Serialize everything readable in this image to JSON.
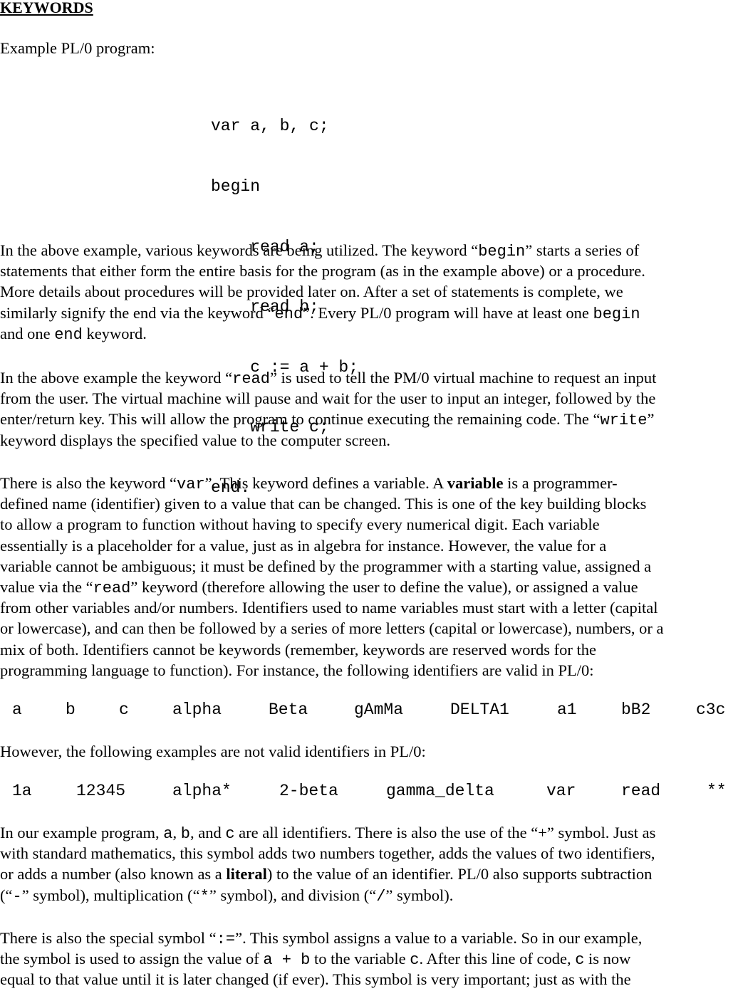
{
  "title": "KEYWORDS",
  "intro": "Example PL/0 program:",
  "code_lines": [
    "var a, b, c;",
    "begin",
    "    read a;",
    "    read b;",
    "    c := a + b;",
    "    write c;",
    "end."
  ],
  "p1": {
    "l1a": "In the above example, various keywords are being utilized.  The keyword “",
    "l1k": "begin",
    "l1b": "” starts a series of",
    "l2": "statements that either form the entire basis for the program (as in the example above) or a procedure.",
    "l3": "More details about procedures will be provided later on.  After a set of statements is complete, we",
    "l4a": "similarly signify the end via the keyword “",
    "l4k": "end",
    "l4b": "”.  Every PL/0 program will have at least one ",
    "l4k2": "begin",
    "l5a": "and one ",
    "l5k": "end",
    "l5b": " keyword."
  },
  "p2": {
    "l1a": "In the above example the keyword “",
    "l1k": "read",
    "l1b": "” is used to tell the PM/0 virtual machine to request an input",
    "l2": "from the user.  The virtual machine will pause and wait for the user to input an integer, followed by the",
    "l3a": "enter/return key.  This will allow the program to continue executing the remaining code.  The “",
    "l3k": "write",
    "l3b": "”",
    "l4": "keyword displays the specified value to the computer screen."
  },
  "p3": {
    "l1a": "There is also the keyword “",
    "l1k": "var",
    "l1b": "”.  This keyword defines a variable.  A ",
    "l1bold": "variable",
    "l1c": " is a programmer-",
    "l2": "defined name (identifier) given to a value that can be changed.  This is one of the key building blocks",
    "l3": "to allow a program to function without having to specify every numerical digit.  Each variable",
    "l4": "essentially is a placeholder for a value, just as in algebra for instance.  However, the value for a",
    "l5": "variable cannot be ambiguous; it must be defined by the programmer with a starting value, assigned a",
    "l6a": "value via the “",
    "l6k": "read",
    "l6b": "” keyword (therefore allowing the user to define the value), or assigned a value",
    "l7": "from other variables and/or numbers.  Identifiers used to name variables must start with a letter (capital",
    "l8": "or lowercase), and can then be followed by a series of more letters (capital or lowercase), numbers, or a",
    "l9": "mix of both.  Identifiers cannot be keywords (remember, keywords are reserved words for the",
    "l10": "programming language to function).  For instance, the following identifiers are valid in PL/0:"
  },
  "valid_identifiers": [
    "a",
    "b",
    "c",
    "alpha",
    "Beta",
    "gAmMa",
    "DELTA1",
    "a1",
    "bB2",
    "c3c"
  ],
  "invalid_intro": "However, the following examples are not valid identifiers in PL/0:",
  "invalid_identifiers": [
    "1a",
    "12345",
    "alpha*",
    "2-beta",
    "gamma_delta",
    "var",
    "read",
    "**"
  ],
  "p4": {
    "l1a": "In our example program, ",
    "l1k1": "a",
    "l1s1": ", ",
    "l1k2": "b",
    "l1s2": ", and ",
    "l1k3": "c",
    "l1b": " are all identifiers.  There is also the use of the “+” symbol.  Just as",
    "l2": "with standard mathematics, this symbol adds two numbers together, adds the values of two identifiers,",
    "l3a": "or adds a number (also known as a ",
    "l3bold": "literal",
    "l3b": ") to the value of an identifier.  PL/0 also supports subtraction",
    "l4a": "(“",
    "l4k1": "-",
    "l4b": "” symbol), multiplication (“",
    "l4k2": "*",
    "l4c": "” symbol), and division (“",
    "l4k3": "/",
    "l4d": "” symbol)."
  },
  "p5": {
    "l1a": "There is also the special symbol “",
    "l1k": ":=",
    "l1b": "”.  This symbol assigns a value to a variable.  So in our example,",
    "l2a": "the symbol is used to assign the value of ",
    "l2k": "a + b",
    "l2b": " to the variable ",
    "l2k2": "c",
    "l2c": ".  After this line of code, ",
    "l2k3": "c",
    "l2d": " is now",
    "l3": "equal to that value until it is later changed (if ever).  This symbol is very important; just as with the"
  }
}
